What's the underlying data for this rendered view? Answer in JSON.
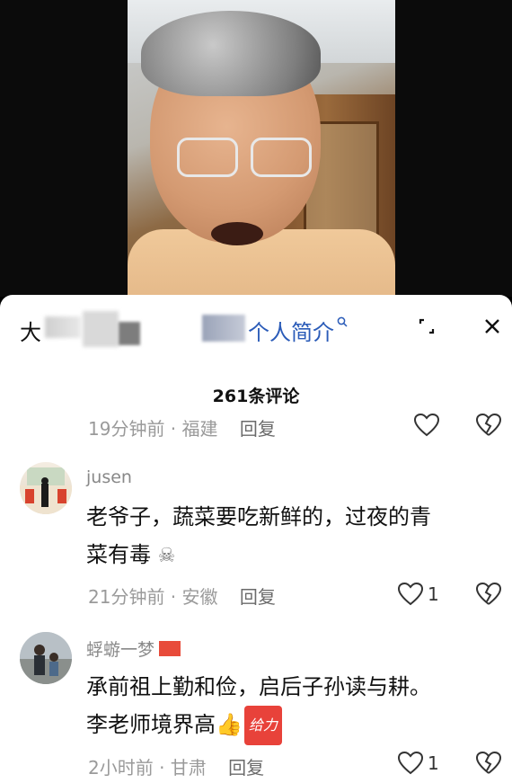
{
  "sheet_header": {
    "name_visible": "大",
    "link_label": "个人简介",
    "link_icon": "search-icon"
  },
  "comment_count": "261条评论",
  "comments": [
    {
      "meta": "19分钟前 · 福建",
      "reply": "回复",
      "likes": ""
    },
    {
      "username": "jusen",
      "text_line1": "老爷子，蔬菜要吃新鲜的，过夜的青",
      "text_line2": "菜有毒",
      "emoji": "skull-crossbones-icon",
      "meta": "21分钟前 · 安徽",
      "reply": "回复",
      "likes": "1"
    },
    {
      "username": "蜉蝣一梦",
      "text_line1": "承前祖上勤和俭，启后子孙读与耕。",
      "text_line2": "李老师境界高",
      "sticker": "给力",
      "meta": "2小时前 · 甘肃",
      "reply": "回复",
      "likes": "1"
    }
  ],
  "colors": {
    "link": "#2a5bb8",
    "meta": "#9a9a9a",
    "text": "#111111"
  }
}
